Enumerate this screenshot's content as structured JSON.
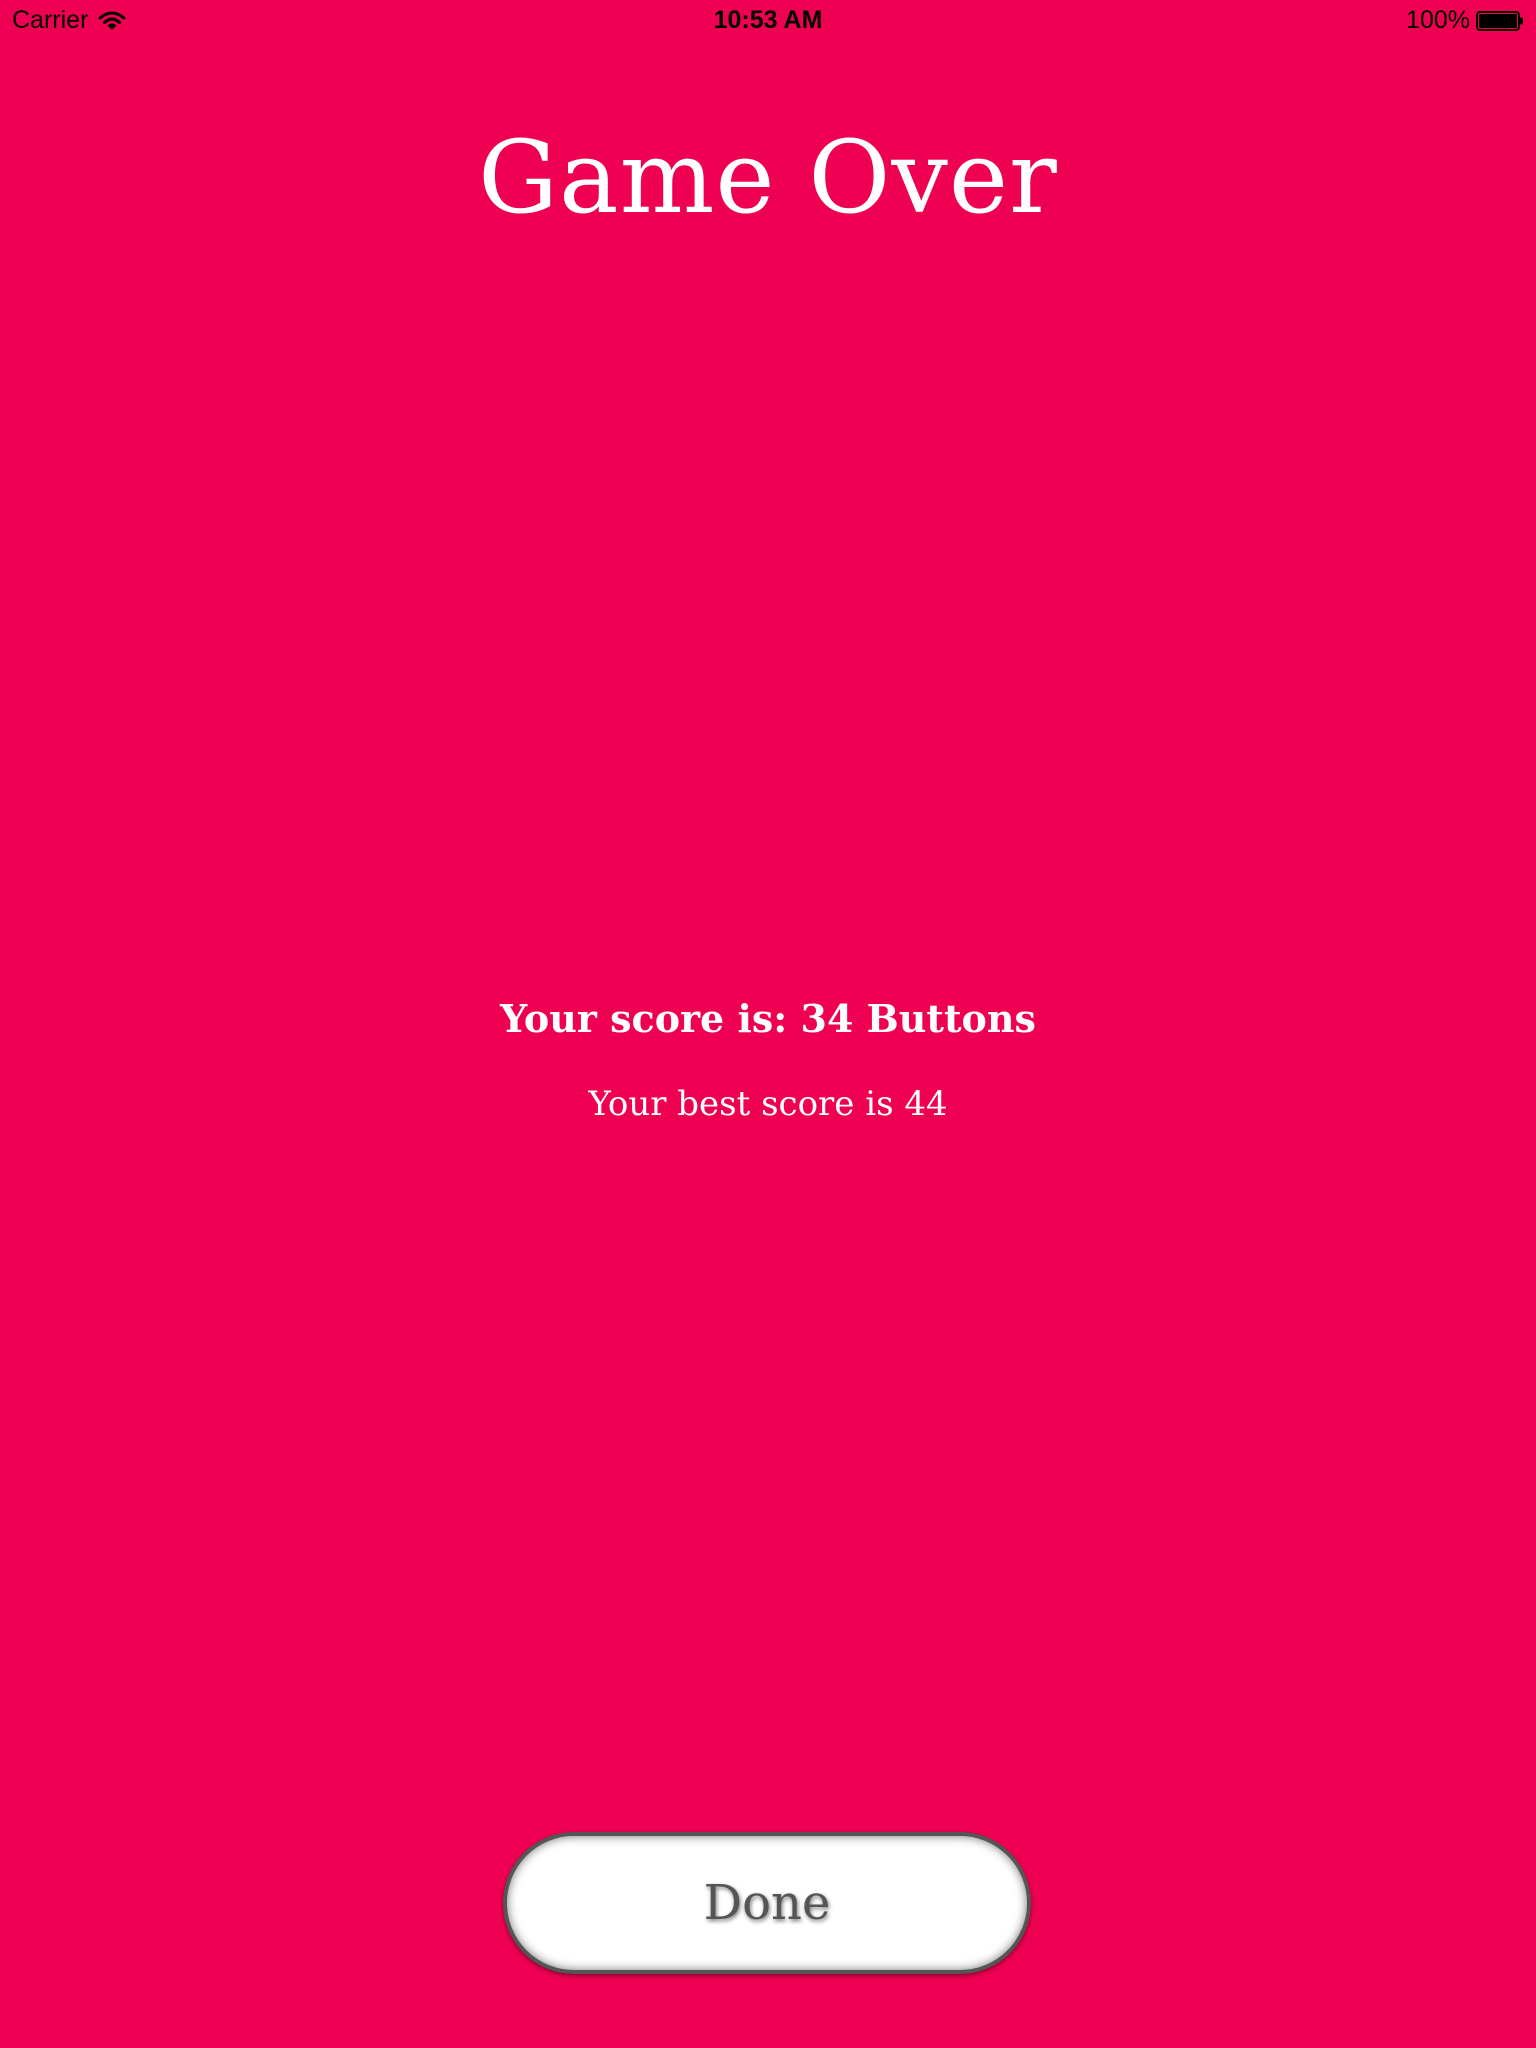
{
  "status_bar": {
    "carrier": "Carrier",
    "wifi_icon": "wifi-icon",
    "time": "10:53 AM",
    "battery_percent": "100%",
    "battery_icon": "battery-icon",
    "battery_level": 1.0
  },
  "game_over": {
    "title": "Game Over",
    "score_text": "Your score is: 34 Buttons",
    "best_score_text": "Your best score is 44"
  },
  "done_button": {
    "label": "Done"
  },
  "colors": {
    "background": "#EE0052",
    "text": "#FFFFFF",
    "button_bg": "#FFFFFF",
    "button_text": "#555555"
  }
}
